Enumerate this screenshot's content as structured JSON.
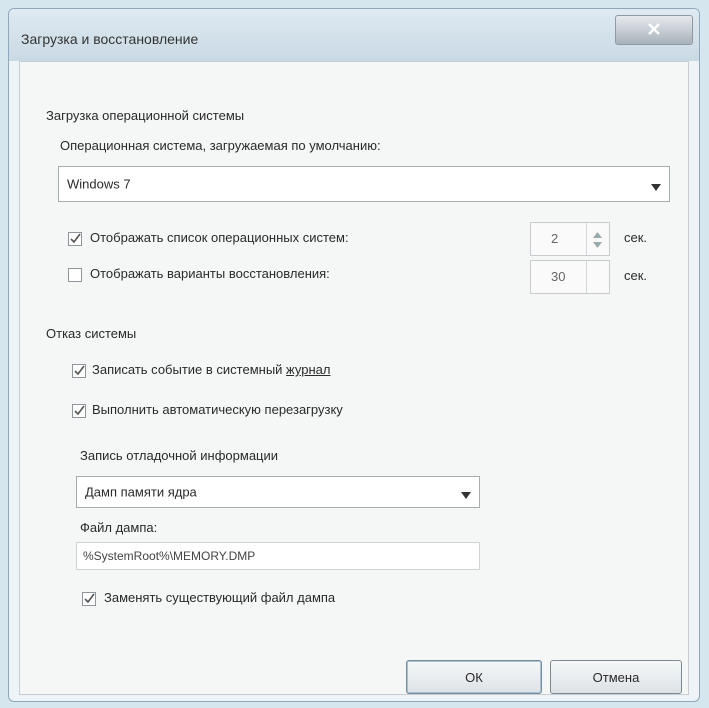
{
  "dialog": {
    "title": "Загрузка и восстановление"
  },
  "startup": {
    "group_label": "Загрузка операционной системы",
    "default_os_label": "Операционная система, загружаемая по умолчанию:",
    "default_os_value": "Windows 7",
    "show_os_list_label": "Отображать список операционных систем:",
    "show_os_list_checked": true,
    "show_os_list_seconds": "2",
    "show_os_list_unit": "сек.",
    "show_recovery_label": "Отображать варианты восстановления:",
    "show_recovery_checked": false,
    "show_recovery_seconds": "30",
    "show_recovery_unit": "сек."
  },
  "failure": {
    "group_label": "Отказ системы",
    "write_event_label_pre": "Записать событие в системный ",
    "write_event_label_link": "журнал",
    "write_event_checked": true,
    "auto_restart_label": "Выполнить автоматическую перезагрузку",
    "auto_restart_checked": true,
    "debug_info_label": "Запись отладочной информации",
    "debug_info_value": "Дамп памяти ядра",
    "dump_file_label": "Файл дампа:",
    "dump_file_value": "%SystemRoot%\\MEMORY.DMP",
    "overwrite_label": "Заменять существующий файл дампа",
    "overwrite_checked": true
  },
  "buttons": {
    "ok": "ОК",
    "cancel": "Отмена"
  },
  "icons": {
    "close": "close-icon",
    "dropdown": "chevron-down-icon",
    "check": "check-icon"
  }
}
